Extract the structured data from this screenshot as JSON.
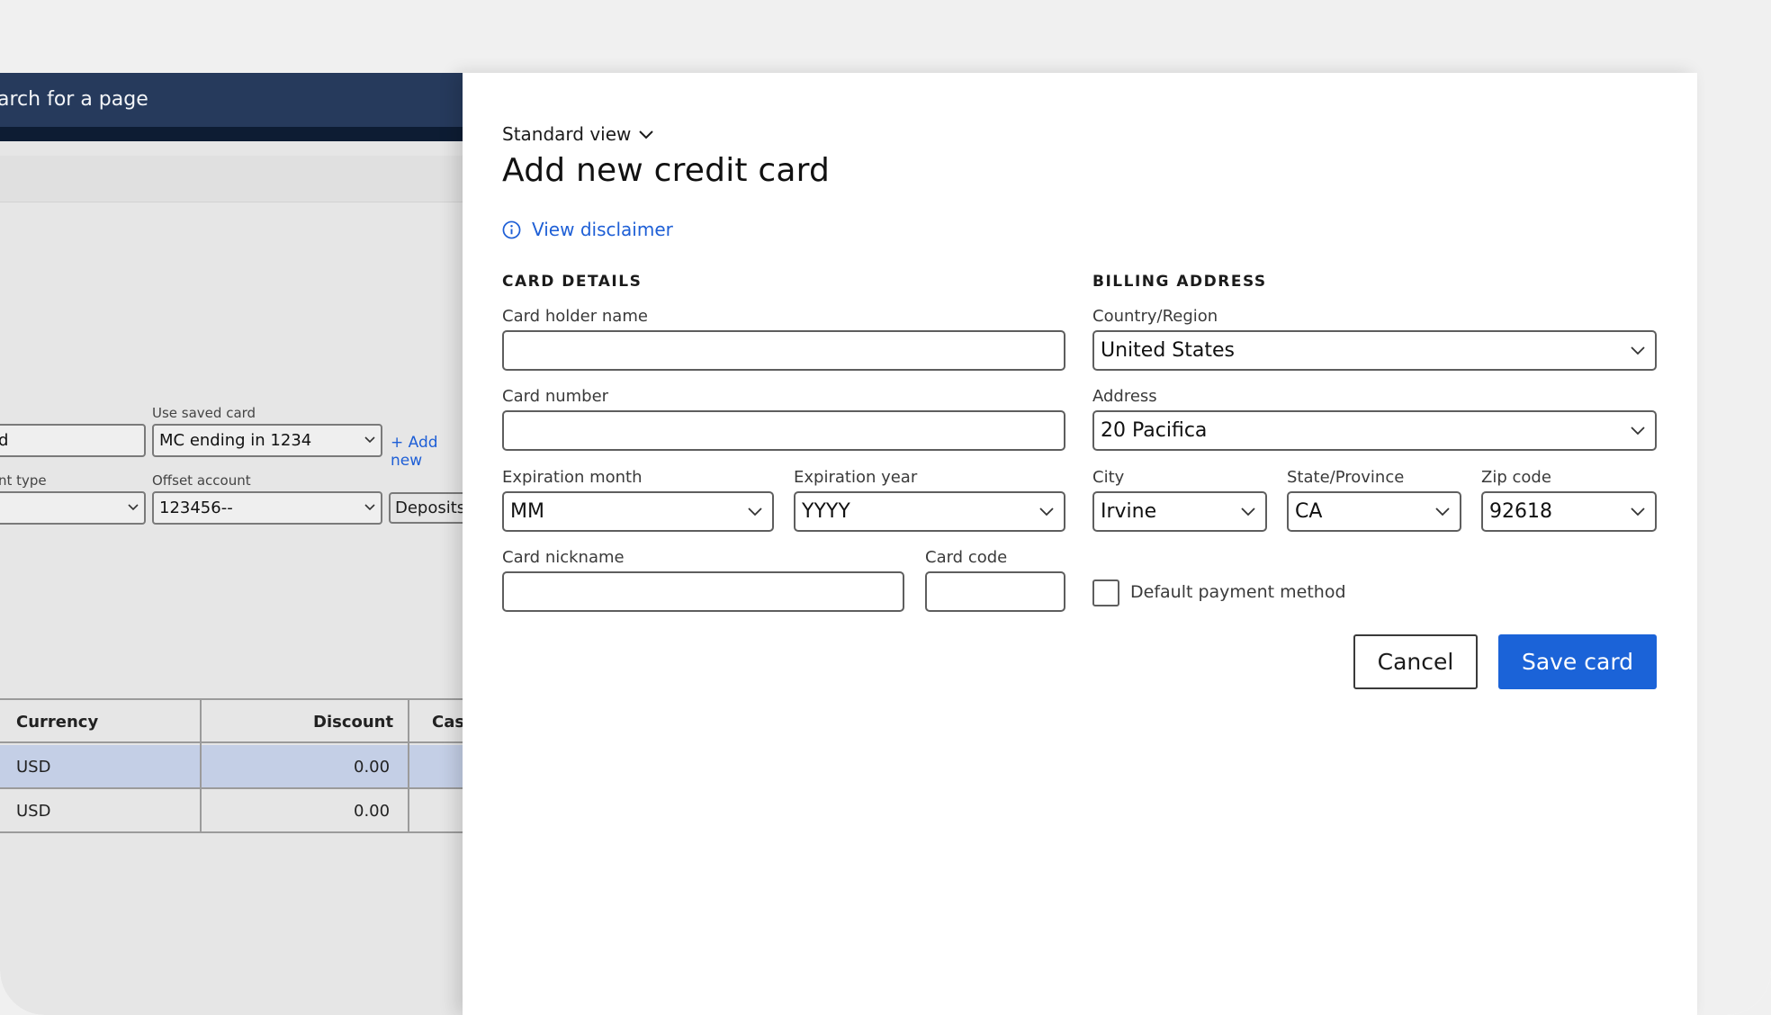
{
  "background_app": {
    "search_text": "arch for a page",
    "use_saved_card_label": "Use saved card",
    "saved_card_value": "MC ending in 1234",
    "add_new_label": "+ Add new",
    "payment_type_label": "nt type",
    "offset_account_label": "Offset account",
    "offset_account_value": "123456--",
    "deposits_label": "Deposits",
    "grid": {
      "columns": [
        "Currency",
        "Discount",
        "Casl"
      ],
      "rows": [
        {
          "currency": "USD",
          "discount": "0.00"
        },
        {
          "currency": "USD",
          "discount": "0.00"
        }
      ]
    }
  },
  "dialog": {
    "view_selector": "Standard view",
    "title": "Add new credit card",
    "disclaimer_link": "View disclaimer",
    "card_details": {
      "heading": "CARD DETAILS",
      "card_holder_label": "Card holder name",
      "card_holder_value": "",
      "card_number_label": "Card number",
      "card_number_value": "",
      "exp_month_label": "Expiration month",
      "exp_month_value": "MM",
      "exp_year_label": "Expiration year",
      "exp_year_value": "YYYY",
      "nickname_label": "Card nickname",
      "nickname_value": "",
      "card_code_label": "Card code",
      "card_code_value": ""
    },
    "billing_address": {
      "heading": "BILLING ADDRESS",
      "country_label": "Country/Region",
      "country_value": "United States",
      "address_label": "Address",
      "address_value": "20 Pacifica",
      "city_label": "City",
      "city_value": "Irvine",
      "state_label": "State/Province",
      "state_value": "CA",
      "zip_label": "Zip code",
      "zip_value": "92618"
    },
    "default_payment_label": "Default payment method",
    "default_payment_checked": false,
    "cancel_label": "Cancel",
    "save_label": "Save card"
  },
  "colors": {
    "accent": "#1b63d8",
    "link": "#1e5fd6",
    "nav_dark": "#0d1c33",
    "grid_selected_row": "#c4cfe6"
  },
  "icons": {
    "view_chevron": "chevron-down-icon",
    "disclaimer": "info-icon",
    "select_chevron": "chevron-down-icon"
  }
}
